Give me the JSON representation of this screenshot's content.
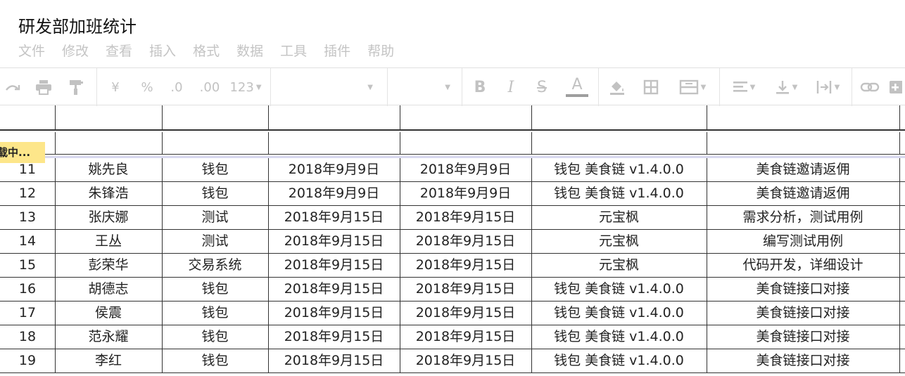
{
  "title": "研发部加班统计",
  "menu": [
    "文件",
    "修改",
    "查看",
    "插入",
    "格式",
    "数据",
    "工具",
    "插件",
    "帮助"
  ],
  "toolbar": {
    "currency": "¥",
    "percent": "%",
    "decimal_decrease": ".0",
    "decimal_increase": ".00",
    "number_format": "123",
    "bold": "B",
    "italic": "I",
    "strike": "S",
    "text_color": "A"
  },
  "loading_badge": "载中...",
  "rows": [
    {
      "num": "11",
      "name": "姚先良",
      "dept": "钱包",
      "start": "2018年9月9日",
      "end": "2018年9月9日",
      "project": "钱包 美食链 v1.4.0.0",
      "task": "美食链邀请返佣"
    },
    {
      "num": "12",
      "name": "朱锋浩",
      "dept": "钱包",
      "start": "2018年9月9日",
      "end": "2018年9月9日",
      "project": "钱包 美食链 v1.4.0.0",
      "task": "美食链邀请返佣"
    },
    {
      "num": "13",
      "name": "张庆娜",
      "dept": "测试",
      "start": "2018年9月15日",
      "end": "2018年9月15日",
      "project": "元宝枫",
      "task": "需求分析，测试用例"
    },
    {
      "num": "14",
      "name": "王丛",
      "dept": "测试",
      "start": "2018年9月15日",
      "end": "2018年9月15日",
      "project": "元宝枫",
      "task": "编写测试用例"
    },
    {
      "num": "15",
      "name": "彭荣华",
      "dept": "交易系统",
      "start": "2018年9月15日",
      "end": "2018年9月15日",
      "project": "元宝枫",
      "task": "代码开发，详细设计"
    },
    {
      "num": "16",
      "name": "胡德志",
      "dept": "钱包",
      "start": "2018年9月15日",
      "end": "2018年9月15日",
      "project": "钱包 美食链 v1.4.0.0",
      "task": "美食链接口对接"
    },
    {
      "num": "17",
      "name": "侯震",
      "dept": "钱包",
      "start": "2018年9月15日",
      "end": "2018年9月15日",
      "project": "钱包 美食链 v1.4.0.0",
      "task": "美食链接口对接"
    },
    {
      "num": "18",
      "name": "范永耀",
      "dept": "钱包",
      "start": "2018年9月15日",
      "end": "2018年9月15日",
      "project": "钱包 美食链 v1.4.0.0",
      "task": "美食链接口对接"
    },
    {
      "num": "19",
      "name": "李红",
      "dept": "钱包",
      "start": "2018年9月15日",
      "end": "2018年9月15日",
      "project": "钱包 美食链 v1.4.0.0",
      "task": "美食链接口对接"
    }
  ]
}
